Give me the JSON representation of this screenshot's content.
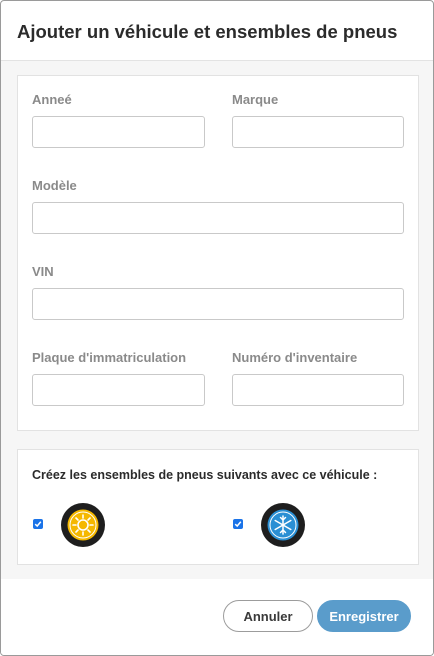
{
  "header": {
    "title": "Ajouter un véhicule et ensembles de pneus"
  },
  "form": {
    "year": {
      "label": "Anneé",
      "value": ""
    },
    "make": {
      "label": "Marque",
      "value": ""
    },
    "model": {
      "label": "Modèle",
      "value": ""
    },
    "vin": {
      "label": "VIN",
      "value": ""
    },
    "plate": {
      "label": "Plaque d'immatriculation",
      "value": ""
    },
    "inventory": {
      "label": "Numéro d'inventaire",
      "value": ""
    }
  },
  "tire_sets": {
    "title": "Créez les ensembles de pneus suivants avec ce véhicule :",
    "items": [
      {
        "icon": "summer-tire-icon",
        "checked": true,
        "accent": "#f5b800"
      },
      {
        "icon": "winter-tire-icon",
        "checked": true,
        "accent": "#2a8fd4"
      }
    ]
  },
  "footer": {
    "cancel_label": "Annuler",
    "save_label": "Enregistrer"
  },
  "colors": {
    "primary": "#5a9ccb",
    "checkbox": "#1a73e8",
    "panel_bg": "#f6f6f6"
  }
}
